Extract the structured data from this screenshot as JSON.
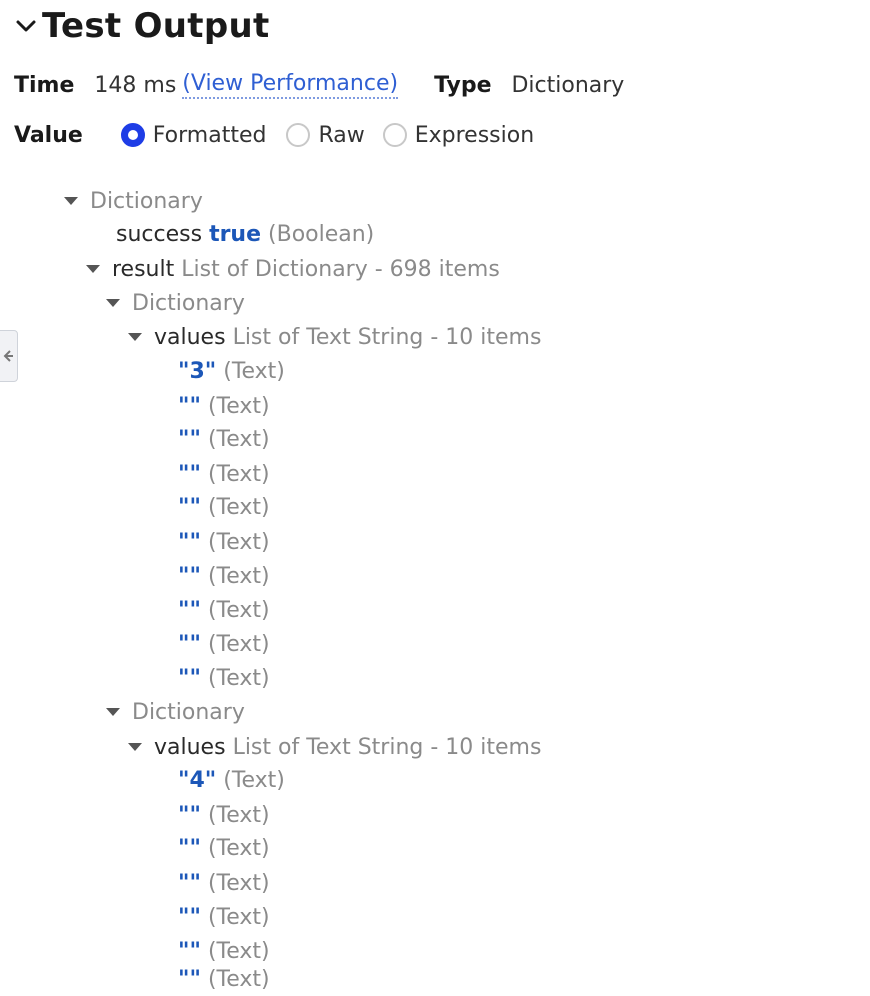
{
  "header": {
    "title": "Test Output"
  },
  "info": {
    "time_label": "Time",
    "time_value": "148 ms",
    "view_perf_link": "(View Performance)",
    "type_label": "Type",
    "type_value": "Dictionary"
  },
  "value_mode": {
    "label": "Value",
    "options": [
      "Formatted",
      "Raw",
      "Expression"
    ],
    "selected": "Formatted"
  },
  "tree": {
    "root_label": "Dictionary",
    "success_key": "success",
    "success_value": "true",
    "success_type": "(Boolean)",
    "result_key": "result",
    "result_meta": "List of Dictionary - 698 items",
    "dict_label": "Dictionary",
    "values_key": "values",
    "values_meta": "List of Text String - 10 items",
    "text_type": "(Text)",
    "empty_string": "\"\"",
    "first_value_1": "\"3\"",
    "first_value_2": "\"4\""
  },
  "colors": {
    "accent": "#1e3de6",
    "link": "#2f5fd3",
    "value_blue": "#1c57b8",
    "muted": "#8a8a8a"
  }
}
